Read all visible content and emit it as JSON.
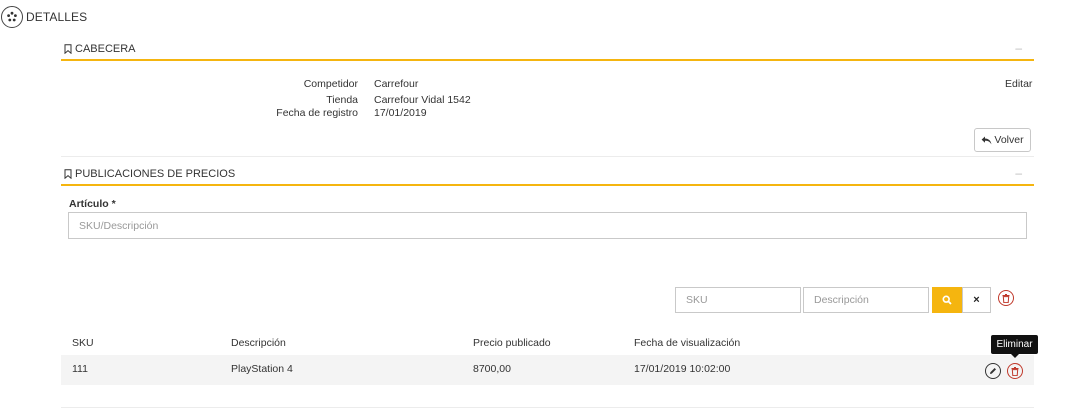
{
  "page": {
    "title": "DETALLES"
  },
  "header_section": {
    "title": "CABECERA",
    "collapse_symbol": "–",
    "fields": [
      {
        "label": "Competidor",
        "value": "Carrefour"
      },
      {
        "label": "Tienda",
        "value": "Carrefour Vidal 1542"
      },
      {
        "label": "Fecha de registro",
        "value": "17/01/2019"
      }
    ],
    "edit_link": "Editar",
    "back_button": "Volver"
  },
  "prices_section": {
    "title": "PUBLICACIONES DE PRECIOS",
    "collapse_symbol": "–",
    "article_label": "Artículo *",
    "article_placeholder": "SKU/Descripción",
    "filters": {
      "sku_placeholder": "SKU",
      "description_placeholder": "Descripción",
      "clear_label": "×"
    },
    "table": {
      "columns": [
        "SKU",
        "Descripción",
        "Precio publicado",
        "Fecha de visualización"
      ],
      "rows": [
        {
          "sku": "111",
          "description": "PlayStation 4",
          "price": "8700,00",
          "date": "17/01/2019 10:02:00"
        }
      ]
    },
    "tooltip": "Eliminar"
  },
  "colors": {
    "accent": "#f5b50f",
    "danger": "#c0392b",
    "row_bg": "#f4f4f4"
  },
  "icons": [
    "gear-icon",
    "bookmark-icon",
    "undo-arrow-icon",
    "search-icon",
    "close-icon",
    "trash-icon",
    "pencil-icon"
  ]
}
